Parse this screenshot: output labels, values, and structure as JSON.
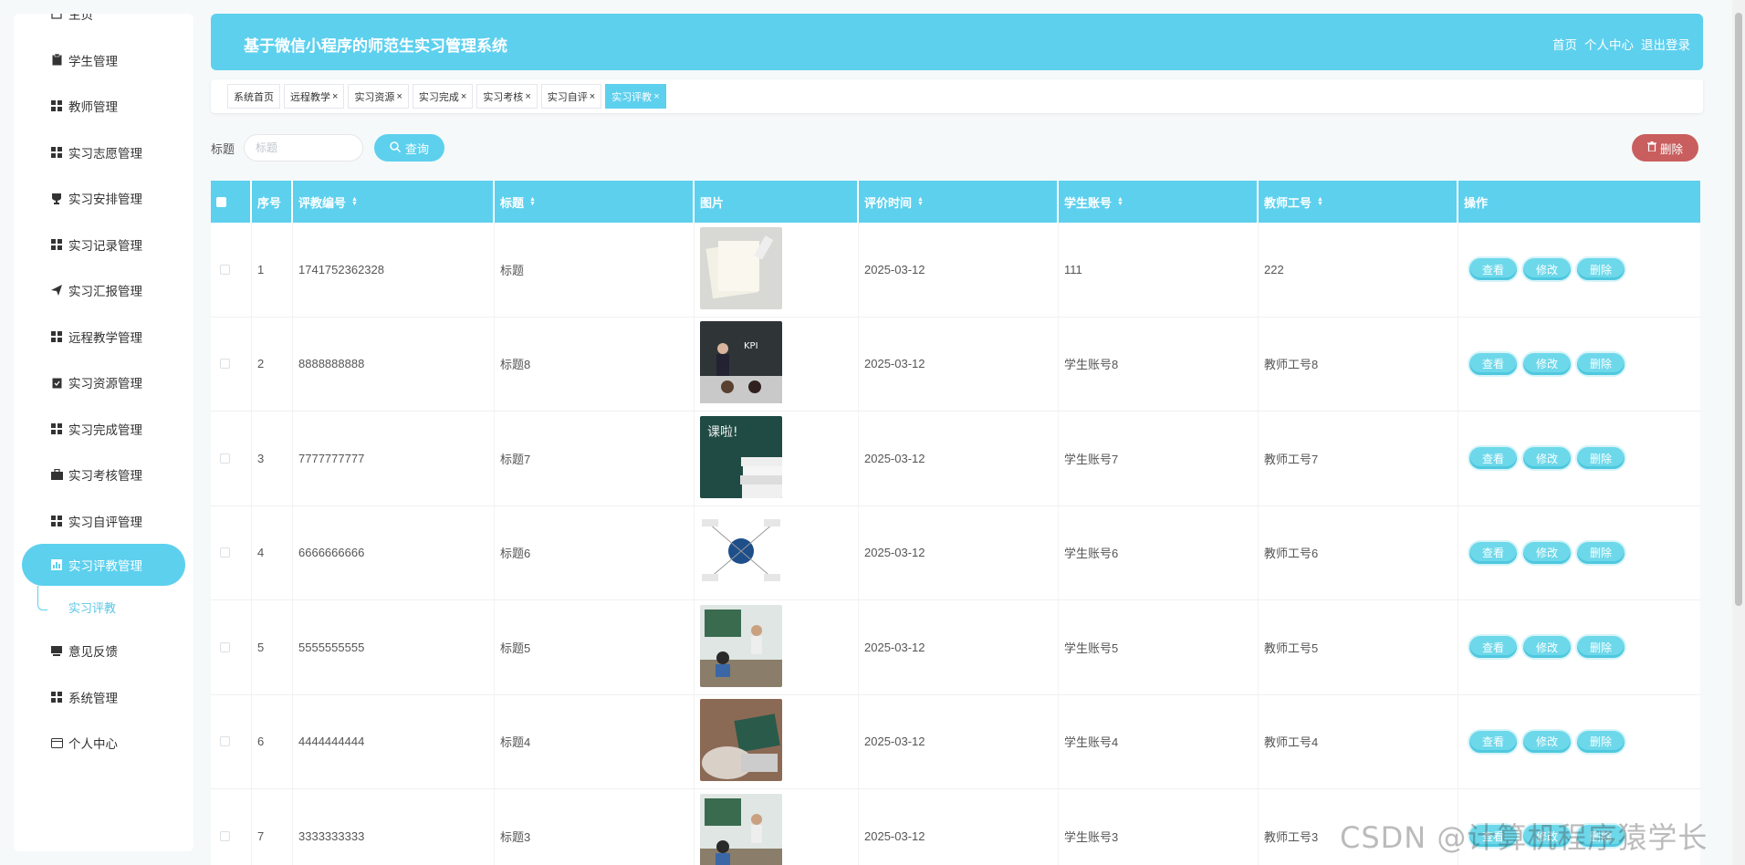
{
  "sidebar": {
    "items": [
      {
        "label": "主页",
        "icon": "home-icon"
      },
      {
        "label": "学生管理",
        "icon": "clipboard-icon"
      },
      {
        "label": "教师管理",
        "icon": "grid-icon"
      },
      {
        "label": "实习志愿管理",
        "icon": "grid-icon"
      },
      {
        "label": "实习安排管理",
        "icon": "trophy-icon"
      },
      {
        "label": "实习记录管理",
        "icon": "grid-icon"
      },
      {
        "label": "实习汇报管理",
        "icon": "send-icon"
      },
      {
        "label": "远程教学管理",
        "icon": "grid-icon"
      },
      {
        "label": "实习资源管理",
        "icon": "clipboard-check-icon"
      },
      {
        "label": "实习完成管理",
        "icon": "grid-icon"
      },
      {
        "label": "实习考核管理",
        "icon": "briefcase-icon"
      },
      {
        "label": "实习自评管理",
        "icon": "grid-icon"
      },
      {
        "label": "实习评教管理",
        "icon": "chart-icon"
      },
      {
        "label": "意见反馈",
        "icon": "monitor-icon"
      },
      {
        "label": "系统管理",
        "icon": "grid-icon"
      },
      {
        "label": "个人中心",
        "icon": "id-card-icon"
      }
    ],
    "sub_item": "实习评教"
  },
  "header": {
    "title": "基于微信小程序的师范生实习管理系统",
    "links": [
      "首页",
      "个人中心",
      "退出登录"
    ]
  },
  "tabs": [
    "系统首页",
    "远程教学",
    "实习资源",
    "实习完成",
    "实习考核",
    "实习自评",
    "实习评教"
  ],
  "search": {
    "label": "标题",
    "placeholder": "标题",
    "button": "查询"
  },
  "delete_button": "删除",
  "table": {
    "headers": [
      "序号",
      "评教编号",
      "标题",
      "图片",
      "评价时间",
      "学生账号",
      "教师工号",
      "操作"
    ],
    "actions": [
      "查看",
      "修改",
      "删除"
    ],
    "rows": [
      [
        "1",
        "1741752362328",
        "标题",
        "2025-03-12",
        "111",
        "222"
      ],
      [
        "2",
        "8888888888",
        "标题8",
        "2025-03-12",
        "学生账号8",
        "教师工号8"
      ],
      [
        "3",
        "7777777777",
        "标题7",
        "2025-03-12",
        "学生账号7",
        "教师工号7"
      ],
      [
        "4",
        "6666666666",
        "标题6",
        "2025-03-12",
        "学生账号6",
        "教师工号6"
      ],
      [
        "5",
        "5555555555",
        "标题5",
        "2025-03-12",
        "学生账号5",
        "教师工号5"
      ],
      [
        "6",
        "4444444444",
        "标题4",
        "2025-03-12",
        "学生账号4",
        "教师工号4"
      ],
      [
        "7",
        "3333333333",
        "标题3",
        "2025-03-12",
        "学生账号3",
        "教师工号3"
      ]
    ]
  },
  "watermark": "CSDN @计算机程序猿学长",
  "colors": {
    "accent": "#5dd0ee",
    "danger": "#c95e5e"
  }
}
